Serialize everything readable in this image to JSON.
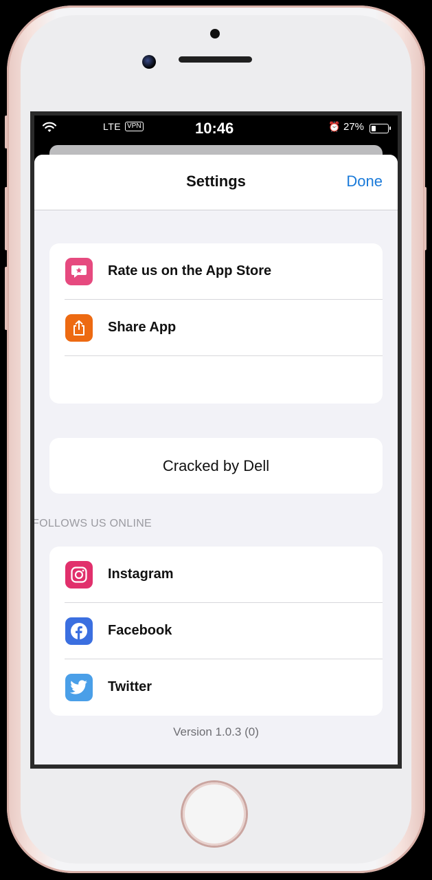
{
  "status_bar": {
    "carrier": "LTE",
    "vpn": "VPN",
    "time": "10:46",
    "battery_percent": "27%"
  },
  "nav": {
    "title": "Settings",
    "done_label": "Done"
  },
  "group1": {
    "items": [
      {
        "label": "Rate us on the App Store",
        "icon": "star-bubble-icon",
        "color": "#e64a7f"
      },
      {
        "label": "Share App",
        "icon": "share-icon",
        "color": "#ed6a12"
      }
    ]
  },
  "cracked_label": "Cracked by Dell",
  "social": {
    "header": "FOLLOWS US ONLINE",
    "items": [
      {
        "label": "Instagram",
        "icon": "instagram-icon",
        "color": "#e1306c"
      },
      {
        "label": "Facebook",
        "icon": "facebook-icon",
        "color": "#3b6fe0"
      },
      {
        "label": "Twitter",
        "icon": "twitter-icon",
        "color": "#4a9fe8"
      }
    ]
  },
  "version": "Version 1.0.3 (0)",
  "colors": {
    "accent": "#1a7ad9",
    "background": "#f2f2f7"
  }
}
